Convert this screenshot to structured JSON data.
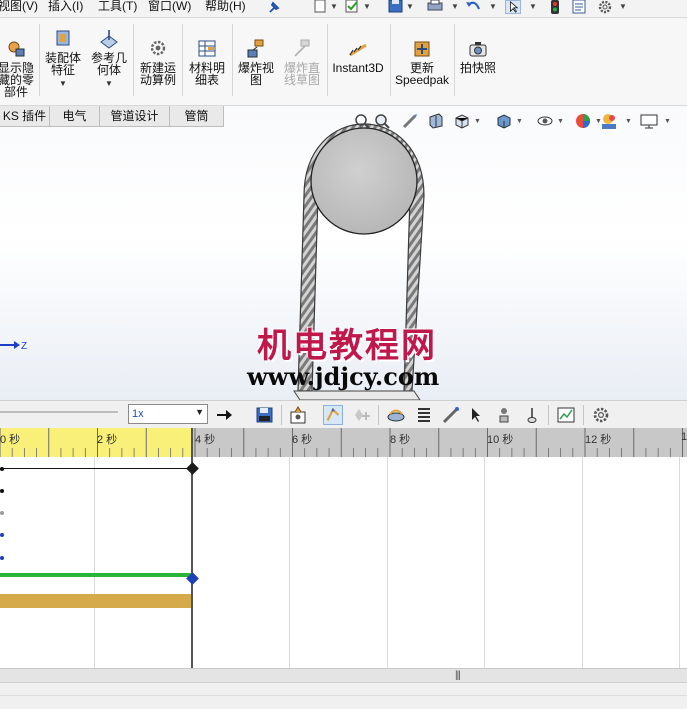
{
  "menu": {
    "items": [
      "视图(V)",
      "插入(I)",
      "工具(T)",
      "窗口(W)",
      "帮助(H)"
    ]
  },
  "quick_access": {
    "icons": [
      "pin-icon",
      "new-document-icon",
      "options-check-icon",
      "save-icon",
      "print-icon",
      "undo-icon",
      "select-cursor-icon",
      "rebuild-traffic-light-icon",
      "file-properties-icon",
      "gear-icon"
    ]
  },
  "ribbon": {
    "buttons": [
      {
        "id": "show-hidden",
        "label_lines": [
          "显示隐",
          "藏的零",
          "部件"
        ],
        "icon": "show-hidden-components-icon",
        "dropdown": false,
        "disabled": false
      },
      {
        "id": "assembly-feature",
        "label_lines": [
          "装配体",
          "特征"
        ],
        "icon": "assembly-feature-icon",
        "dropdown": true,
        "disabled": false
      },
      {
        "id": "reference-geometry",
        "label_lines": [
          "参考几",
          "何体"
        ],
        "icon": "reference-geometry-icon",
        "dropdown": true,
        "disabled": false
      },
      {
        "id": "new-motion-study",
        "label_lines": [
          "新建运",
          "动算例"
        ],
        "icon": "new-motion-study-icon",
        "dropdown": false,
        "disabled": false
      },
      {
        "id": "bom",
        "label_lines": [
          "材料明",
          "细表"
        ],
        "icon": "bill-of-materials-icon",
        "dropdown": false,
        "disabled": false
      },
      {
        "id": "exploded-view",
        "label_lines": [
          "爆炸视",
          "图"
        ],
        "icon": "exploded-view-icon",
        "dropdown": false,
        "disabled": false
      },
      {
        "id": "explode-line-sketch",
        "label_lines": [
          "爆炸直",
          "线草图"
        ],
        "icon": "explode-line-sketch-icon",
        "dropdown": false,
        "disabled": true
      },
      {
        "id": "instant3d",
        "label_lines": [
          "Instant3D"
        ],
        "icon": "instant3d-icon",
        "dropdown": false,
        "disabled": false
      },
      {
        "id": "update-speedpak",
        "label_lines": [
          "更新",
          "Speedpak"
        ],
        "icon": "speedpak-icon",
        "dropdown": false,
        "disabled": false
      },
      {
        "id": "take-snapshot",
        "label_lines": [
          "拍快照"
        ],
        "icon": "camera-icon",
        "dropdown": false,
        "disabled": false
      }
    ]
  },
  "tabs": [
    "KS 插件",
    "电气",
    "管道设计",
    "管筒"
  ],
  "view_toolbar": {
    "icons": [
      "zoom-to-fit-icon",
      "zoom-area-icon",
      "previous-view-icon",
      "section-view-icon",
      "view-orientation-icon",
      "display-style-icon",
      "hide-show-items-icon",
      "edit-appearance-icon",
      "apply-scene-icon",
      "view-settings-icon"
    ]
  },
  "triad": {
    "axis_label": "Z"
  },
  "watermark": {
    "cn": "机电教程网",
    "url": "www.jdjcy.com"
  },
  "motion_toolbar": {
    "playback_speed": "1x",
    "icons": [
      "play-from-start-icon",
      "save-animation-icon",
      "animation-wizard-icon",
      "autokey-icon",
      "add-key-icon",
      "motor-icon",
      "spring-icon",
      "damper-icon",
      "force-icon",
      "contact-icon",
      "gravity-icon",
      "results-plot-icon",
      "motion-study-properties-icon"
    ]
  },
  "timeline": {
    "tick_labels": [
      "0 秒",
      "2 秒",
      "4 秒",
      "6 秒",
      "8 秒",
      "10 秒",
      "12 秒",
      "1"
    ],
    "current_time_sec": 4,
    "colors": {
      "ruler_active": "#f9f07a",
      "ruler_inactive": "#c8c8c8",
      "motor_bar": "#2bb43a",
      "component_bar": "#d4aa4a",
      "key_diamond_dark": "#1b1b1b",
      "key_diamond_blue": "#1f3fb8"
    }
  }
}
